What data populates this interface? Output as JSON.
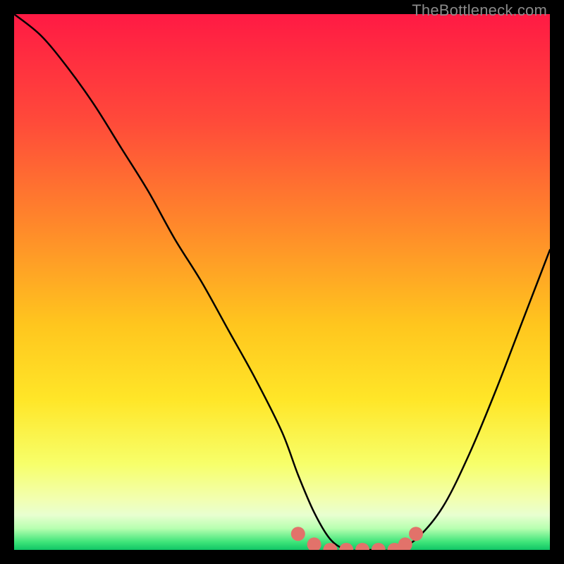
{
  "watermark": "TheBottleneck.com",
  "chart_data": {
    "type": "line",
    "title": "",
    "xlabel": "",
    "ylabel": "",
    "xlim": [
      0,
      100
    ],
    "ylim": [
      0,
      100
    ],
    "series": [
      {
        "name": "bottleneck-curve",
        "x": [
          0,
          5,
          10,
          15,
          20,
          25,
          30,
          35,
          40,
          45,
          50,
          53,
          56,
          59,
          62,
          65,
          68,
          71,
          75,
          80,
          85,
          90,
          95,
          100
        ],
        "values": [
          100,
          96,
          90,
          83,
          75,
          67,
          58,
          50,
          41,
          32,
          22,
          14,
          7,
          2,
          0,
          0,
          0,
          0,
          2,
          8,
          18,
          30,
          43,
          56
        ]
      },
      {
        "name": "markers",
        "x": [
          53,
          56,
          59,
          62,
          65,
          68,
          71,
          73,
          75
        ],
        "values": [
          3,
          1,
          0,
          0,
          0,
          0,
          0,
          1,
          3
        ]
      }
    ],
    "gradient_stops": [
      {
        "offset": 0.0,
        "color": "#ff1a44"
      },
      {
        "offset": 0.2,
        "color": "#ff4a3a"
      },
      {
        "offset": 0.4,
        "color": "#ff8a2a"
      },
      {
        "offset": 0.58,
        "color": "#ffc61e"
      },
      {
        "offset": 0.72,
        "color": "#ffe628"
      },
      {
        "offset": 0.84,
        "color": "#f7ff6a"
      },
      {
        "offset": 0.905,
        "color": "#f2ffb0"
      },
      {
        "offset": 0.935,
        "color": "#e8ffd0"
      },
      {
        "offset": 0.96,
        "color": "#b7ffb0"
      },
      {
        "offset": 0.985,
        "color": "#3fe57a"
      },
      {
        "offset": 1.0,
        "color": "#10c565"
      }
    ],
    "marker_color": "#e2726a",
    "curve_color": "#000000"
  }
}
